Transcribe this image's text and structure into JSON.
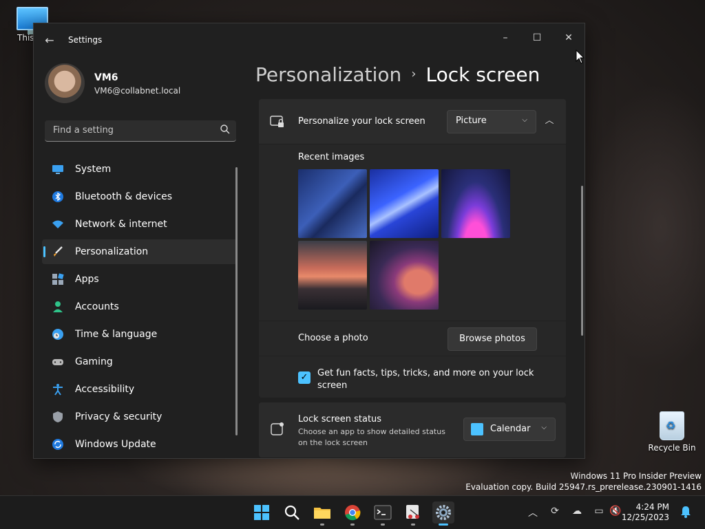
{
  "desktop": {
    "this_pc_label": "This PC",
    "recycle_bin_label": "Recycle Bin",
    "watermark_line1": "Windows 11 Pro Insider Preview",
    "watermark_line2": "Evaluation copy. Build 25947.rs_prerelease.230901-1416"
  },
  "window": {
    "title": "Settings",
    "controls": {
      "minimize": "–",
      "maximize": "☐",
      "close": "✕"
    },
    "back_icon": "←"
  },
  "user": {
    "name": "VM6",
    "email": "VM6@collabnet.local"
  },
  "search": {
    "placeholder": "Find a setting"
  },
  "sidebar": {
    "items": [
      {
        "label": "System",
        "icon": "monitor-icon",
        "selected": false
      },
      {
        "label": "Bluetooth & devices",
        "icon": "bluetooth-icon",
        "selected": false
      },
      {
        "label": "Network & internet",
        "icon": "wifi-icon",
        "selected": false
      },
      {
        "label": "Personalization",
        "icon": "brush-icon",
        "selected": true
      },
      {
        "label": "Apps",
        "icon": "apps-icon",
        "selected": false
      },
      {
        "label": "Accounts",
        "icon": "person-icon",
        "selected": false
      },
      {
        "label": "Time & language",
        "icon": "globe-clock-icon",
        "selected": false
      },
      {
        "label": "Gaming",
        "icon": "gamepad-icon",
        "selected": false
      },
      {
        "label": "Accessibility",
        "icon": "accessibility-icon",
        "selected": false
      },
      {
        "label": "Privacy & security",
        "icon": "shield-icon",
        "selected": false
      },
      {
        "label": "Windows Update",
        "icon": "update-icon",
        "selected": false
      }
    ]
  },
  "breadcrumb": {
    "parent": "Personalization",
    "separator": "›",
    "current": "Lock screen"
  },
  "lock_screen": {
    "personalize_title": "Personalize your lock screen",
    "personalize_value": "Picture",
    "recent_images_label": "Recent images",
    "choose_photo_label": "Choose a photo",
    "browse_button": "Browse photos",
    "tips_checked": true,
    "tips_label": "Get fun facts, tips, tricks, and more on your lock screen",
    "status_title": "Lock screen status",
    "status_subtitle": "Choose an app to show detailed status on the lock screen",
    "status_value": "Calendar"
  },
  "taskbar": {
    "clock_time": "4:24 PM",
    "clock_date": "12/25/2023",
    "apps": [
      "start-icon",
      "search-icon",
      "file-explorer-icon",
      "chrome-icon",
      "terminal-icon",
      "snipping-tool-icon",
      "settings-icon"
    ]
  },
  "colors": {
    "accent": "#4cc2ff",
    "window_bg": "#202020",
    "card_bg": "#2b2b2b"
  }
}
